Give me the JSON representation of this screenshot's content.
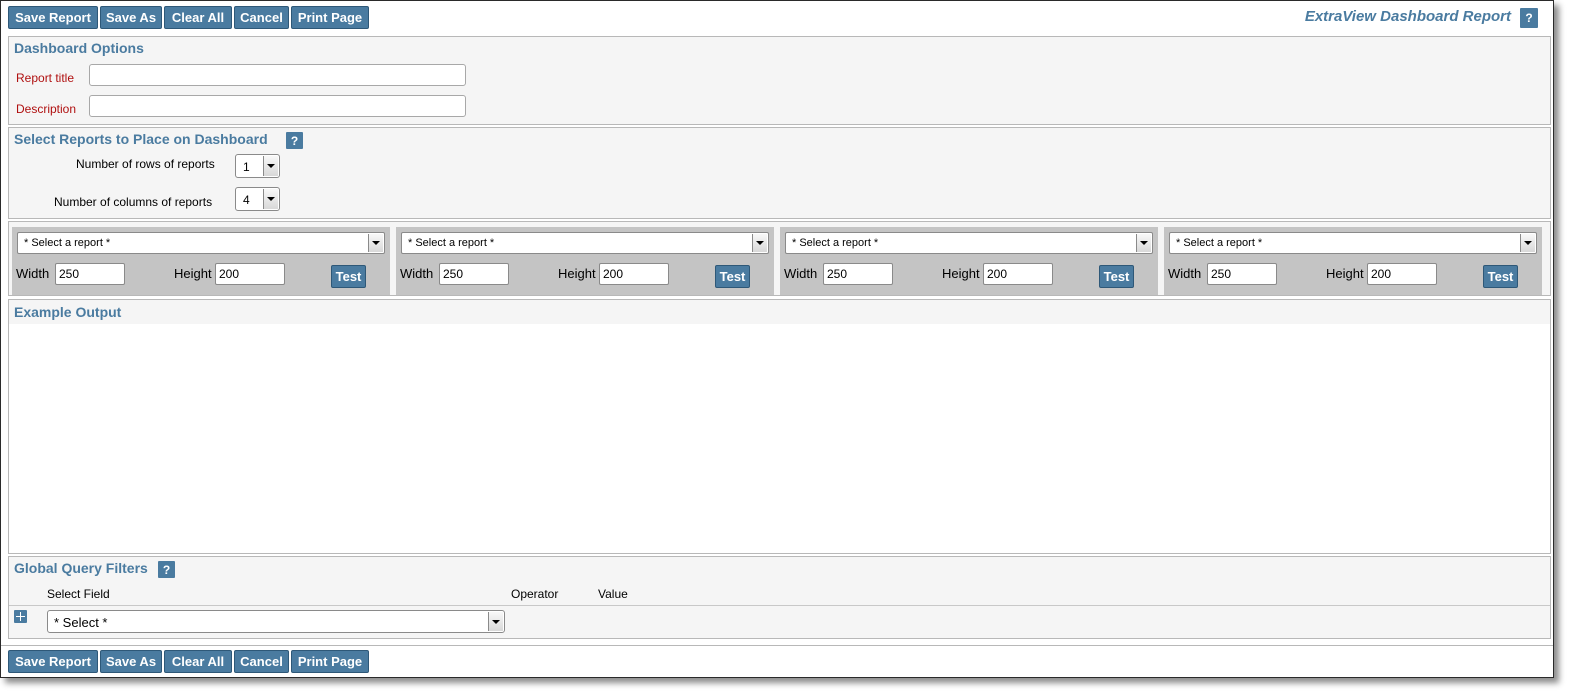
{
  "toolbar": {
    "save_report": "Save Report",
    "save_as": "Save As",
    "clear_all": "Clear All",
    "cancel": "Cancel",
    "print_page": "Print Page"
  },
  "app_title": "ExtraView Dashboard Report",
  "help_label": "?",
  "dashboard_options": {
    "title": "Dashboard Options",
    "report_title_label": "Report title",
    "report_title_value": "",
    "description_label": "Description",
    "description_value": ""
  },
  "select_reports": {
    "title": "Select Reports to Place on Dashboard",
    "rows_label": "Number of rows of reports",
    "rows_value": "1",
    "cols_label": "Number of columns of reports",
    "cols_value": "4"
  },
  "report_panels": [
    {
      "select": "* Select a report *",
      "width_label": "Width",
      "width": "250",
      "height_label": "Height",
      "height": "200",
      "test": "Test"
    },
    {
      "select": "* Select a report *",
      "width_label": "Width",
      "width": "250",
      "height_label": "Height",
      "height": "200",
      "test": "Test"
    },
    {
      "select": "* Select a report *",
      "width_label": "Width",
      "width": "250",
      "height_label": "Height",
      "height": "200",
      "test": "Test"
    },
    {
      "select": "* Select a report *",
      "width_label": "Width",
      "width": "250",
      "height_label": "Height",
      "height": "200",
      "test": "Test"
    }
  ],
  "example_output": {
    "title": "Example Output"
  },
  "global_filters": {
    "title": "Global Query Filters",
    "col_select_field": "Select Field",
    "col_operator": "Operator",
    "col_value": "Value",
    "select_value": "* Select *"
  },
  "colors": {
    "accent": "#4a7ba0",
    "required_label": "#b01010",
    "panel_bg": "#c4c4c4"
  }
}
